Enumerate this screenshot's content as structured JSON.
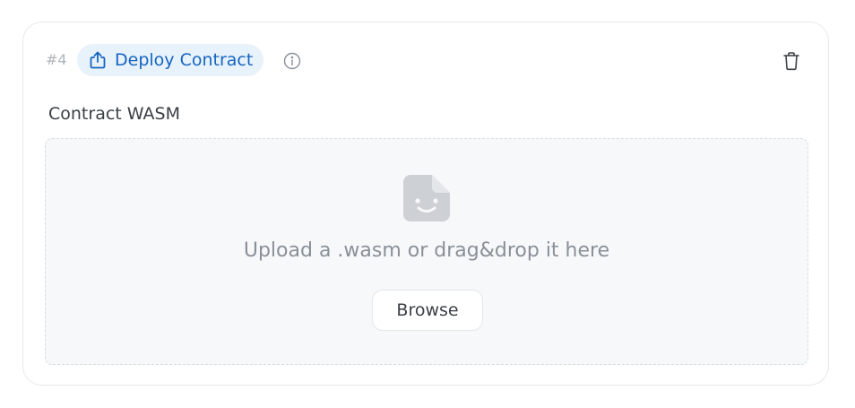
{
  "step": {
    "number": "#4",
    "operation_label": "Deploy Contract",
    "operation_icon": "upload-share-icon",
    "info_icon": "info-circle-icon",
    "delete_icon": "trash-icon"
  },
  "field": {
    "label": "Contract WASM"
  },
  "dropzone": {
    "icon": "file-smile-icon",
    "text": "Upload a .wasm or drag&drop it here",
    "browse_label": "Browse"
  },
  "colors": {
    "accent": "#1565c0",
    "badge_bg": "#e8f2fb",
    "muted_text": "#8a9099",
    "dropzone_bg": "#f7f8f9",
    "icon_gray": "#cdd1d6"
  }
}
